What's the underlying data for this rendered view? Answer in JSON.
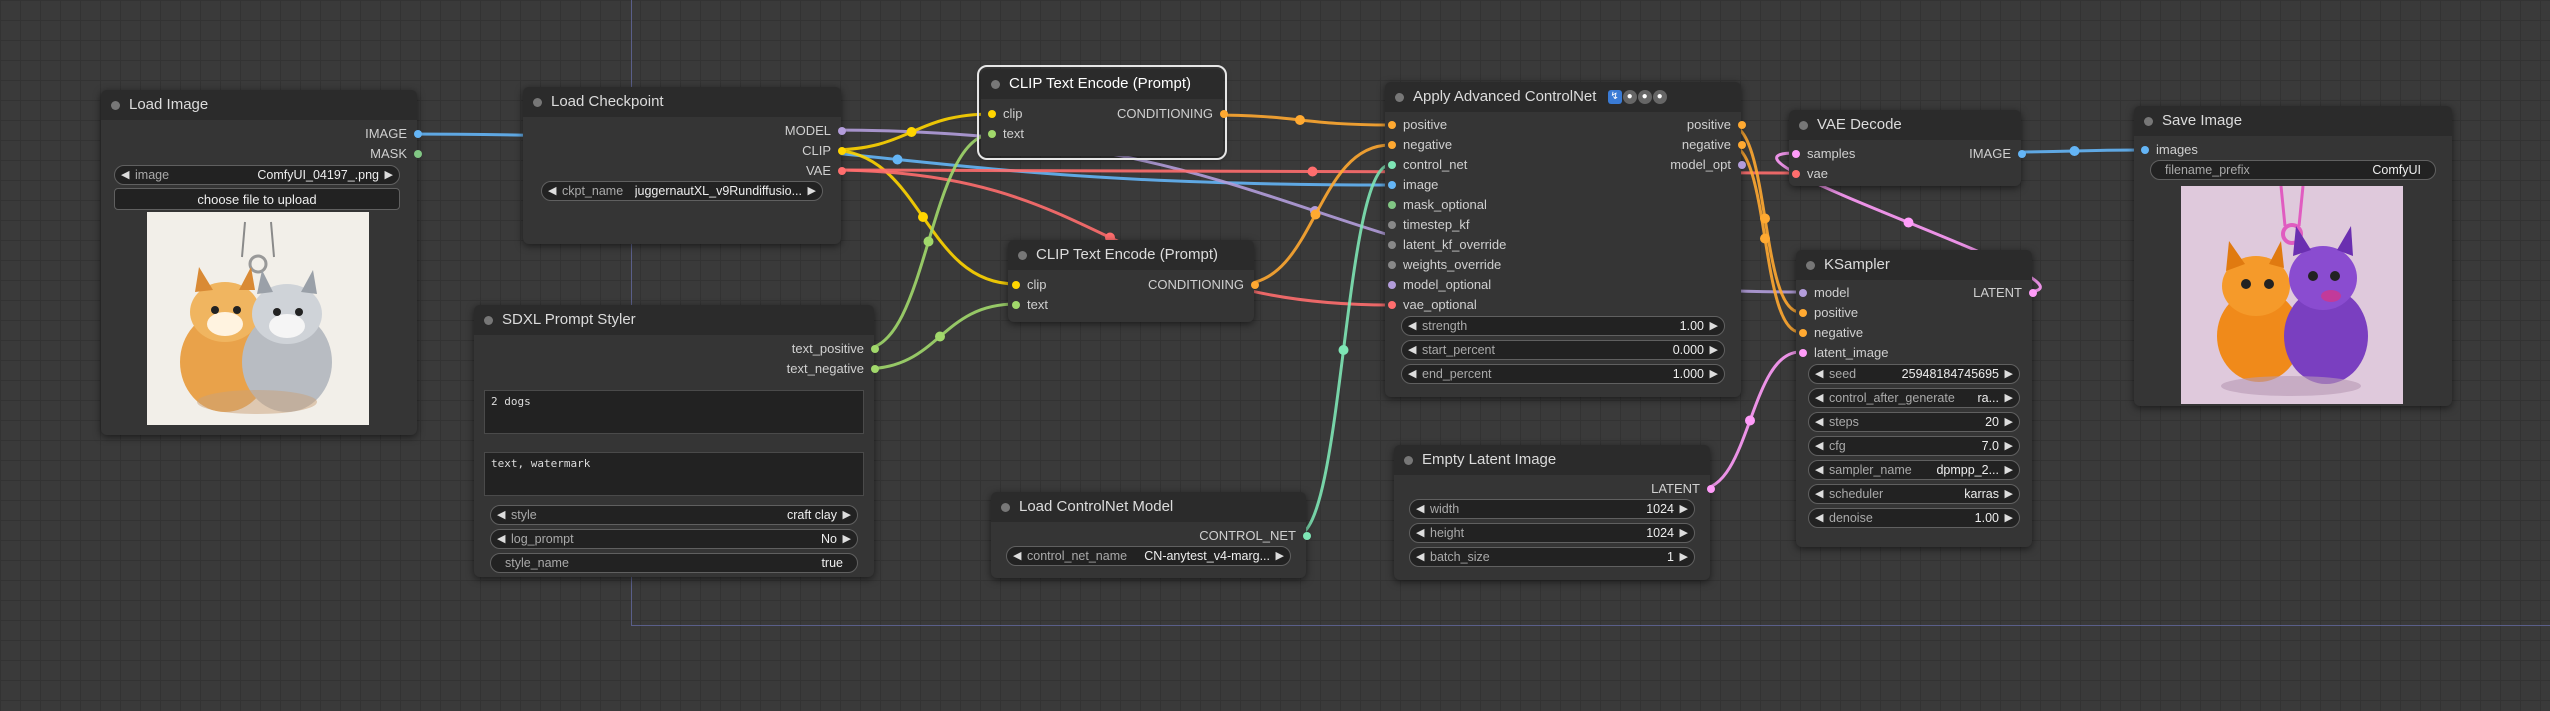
{
  "colors": {
    "IMAGE": "#64b5f6",
    "MASK": "#81c784",
    "MODEL": "#b39ddb",
    "CLIP": "#ffd500",
    "VAE": "#ff6e6e",
    "CONDITIONING": "#ffa931",
    "CONTROL_NET": "#7ee6b5",
    "LATENT": "#ff9cf9",
    "STRING": "#a1d86b",
    "OTHER": "#888888"
  },
  "nodes": {
    "load_image": {
      "title": "Load Image",
      "outputs": [
        "IMAGE",
        "MASK"
      ],
      "image_widget": {
        "label": "image",
        "value": "ComfyUI_04197_.png"
      },
      "upload_button": "choose file to upload",
      "preview_icon": "two-puppies-pendant-illustration"
    },
    "load_checkpoint": {
      "title": "Load Checkpoint",
      "outputs": [
        "MODEL",
        "CLIP",
        "VAE"
      ],
      "ckpt_widget": {
        "label": "ckpt_name",
        "value": "juggernautXL_v9Rundiffusio..."
      }
    },
    "sdxl_styler": {
      "title": "SDXL Prompt Styler",
      "outputs": [
        "text_positive",
        "text_negative"
      ],
      "positive_text": "2 dogs",
      "negative_text": "text, watermark",
      "style": {
        "label": "style",
        "value": "craft clay"
      },
      "log_prompt": {
        "label": "log_prompt",
        "value": "No"
      },
      "style_name": {
        "label": "style_name",
        "value": "true"
      }
    },
    "clip_encode_1": {
      "title": "CLIP Text Encode (Prompt)",
      "inputs": [
        "clip",
        "text"
      ],
      "outputs": [
        "CONDITIONING"
      ]
    },
    "clip_encode_2": {
      "title": "CLIP Text Encode (Prompt)",
      "inputs": [
        "clip",
        "text"
      ],
      "outputs": [
        "CONDITIONING"
      ]
    },
    "load_controlnet": {
      "title": "Load ControlNet Model",
      "outputs": [
        "CONTROL_NET"
      ],
      "cn_widget": {
        "label": "control_net_name",
        "value": "CN-anytest_v4-marg..."
      }
    },
    "apply_controlnet": {
      "title": "Apply Advanced ControlNet",
      "inputs": [
        "positive",
        "negative",
        "control_net",
        "image",
        "mask_optional",
        "timestep_kf",
        "latent_kf_override",
        "weights_override",
        "model_optional",
        "vae_optional"
      ],
      "outputs": [
        "positive",
        "negative",
        "model_opt"
      ],
      "strength": {
        "label": "strength",
        "value": "1.00"
      },
      "start_percent": {
        "label": "start_percent",
        "value": "0.000"
      },
      "end_percent": {
        "label": "end_percent",
        "value": "1.000"
      }
    },
    "empty_latent": {
      "title": "Empty Latent Image",
      "outputs": [
        "LATENT"
      ],
      "width": {
        "label": "width",
        "value": "1024"
      },
      "height": {
        "label": "height",
        "value": "1024"
      },
      "batch_size": {
        "label": "batch_size",
        "value": "1"
      }
    },
    "vae_decode": {
      "title": "VAE Decode",
      "inputs": [
        "samples",
        "vae"
      ],
      "outputs": [
        "IMAGE"
      ]
    },
    "ksampler": {
      "title": "KSampler",
      "inputs": [
        "model",
        "positive",
        "negative",
        "latent_image"
      ],
      "outputs": [
        "LATENT"
      ],
      "seed": {
        "label": "seed",
        "value": "25948184745695"
      },
      "control_after_generate": {
        "label": "control_after_generate",
        "value": "ra..."
      },
      "steps": {
        "label": "steps",
        "value": "20"
      },
      "cfg": {
        "label": "cfg",
        "value": "7.0"
      },
      "sampler_name": {
        "label": "sampler_name",
        "value": "dpmpp_2..."
      },
      "scheduler": {
        "label": "scheduler",
        "value": "karras"
      },
      "denoise": {
        "label": "denoise",
        "value": "1.00"
      }
    },
    "save_image": {
      "title": "Save Image",
      "inputs": [
        "images"
      ],
      "filename_prefix": {
        "label": "filename_prefix",
        "value": "ComfyUI"
      },
      "preview_icon": "two-clay-dogs-render"
    }
  }
}
